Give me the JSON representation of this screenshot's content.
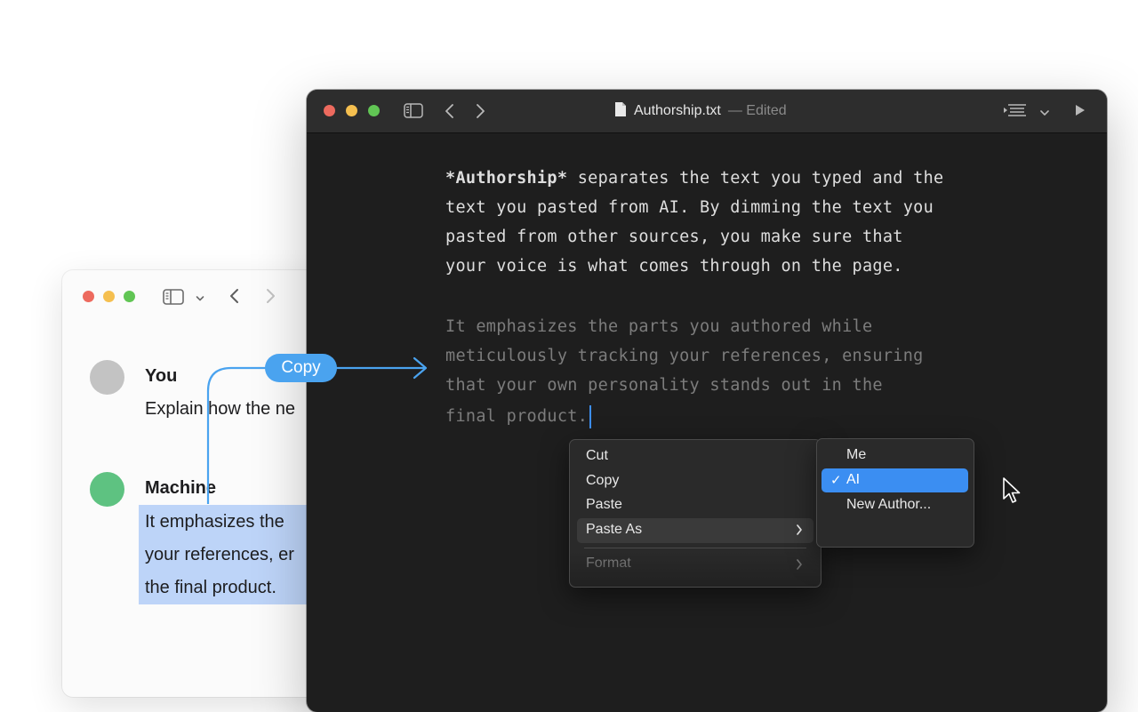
{
  "chat_window": {
    "authors": [
      {
        "name": "You",
        "message": "Explain how the ne"
      },
      {
        "name": "Machine",
        "message_lines": [
          "It emphasizes the",
          "your references, er",
          "the final product."
        ]
      }
    ]
  },
  "editor": {
    "file_name": "Authorship.txt",
    "status": "— Edited",
    "paragraph1": {
      "bold": "*Authorship*",
      "lines": [
        " separates the text you typed and the",
        "text you pasted from AI. By dimming the text you",
        "pasted from other sources, you make sure that",
        "your voice is what comes through on the page."
      ]
    },
    "paragraph2": {
      "lines": [
        "It emphasizes the parts you authored while",
        "meticulously tracking your references, ensuring",
        "that your own personality stands out in the",
        "final product."
      ]
    }
  },
  "context_menu": {
    "items": [
      "Cut",
      "Copy",
      "Paste",
      "Paste As",
      "Format"
    ]
  },
  "paste_as_submenu": {
    "items": [
      "Me",
      "AI",
      "New Author..."
    ],
    "selected": "AI",
    "check": "✓"
  },
  "copy_label": "Copy",
  "colors": {
    "accent": "#3b8ef2",
    "flow_arrow": "#4aa3ef",
    "you_avatar": "#c3c3c3",
    "machine_avatar": "#5ec281",
    "highlight": "#bdd4f8"
  }
}
